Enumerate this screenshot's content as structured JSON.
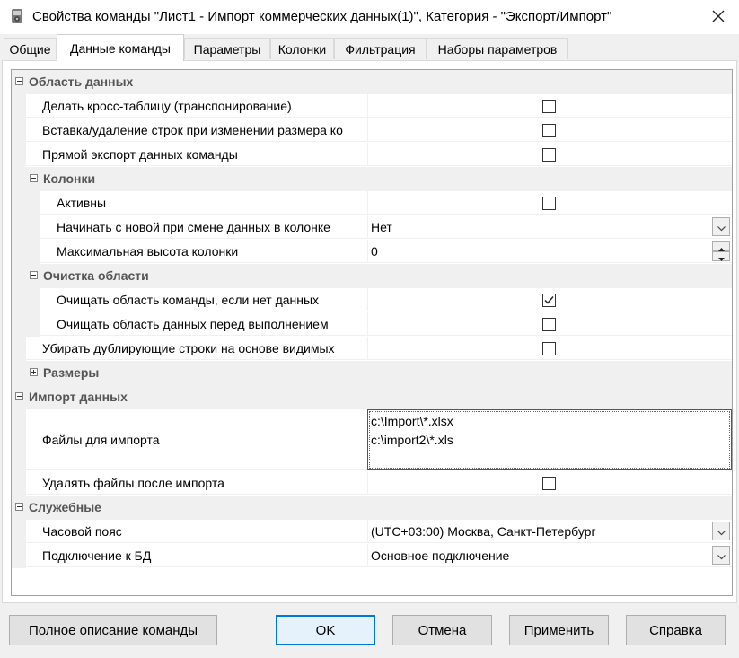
{
  "window": {
    "title": "Свойства команды \"Лист1 - Импорт коммерческих данных(1)\", Категория - \"Экспорт/Импорт\"",
    "icon": "gear-icon",
    "close_glyph": "✕"
  },
  "tabs": [
    {
      "label": "Общие",
      "active": false
    },
    {
      "label": "Данные команды",
      "active": true
    },
    {
      "label": "Параметры",
      "active": false
    },
    {
      "label": "Колонки",
      "active": false
    },
    {
      "label": "Фильтрация",
      "active": false
    },
    {
      "label": "Наборы параметров",
      "active": false
    }
  ],
  "grid": {
    "cat_data_area": "Область данных",
    "cross_table": {
      "label": "Делать кросс-таблицу (транспонирование)",
      "checked": false
    },
    "insert_delete_rows": {
      "label": "Вставка/удаление строк при изменении размера ко",
      "checked": false
    },
    "direct_export": {
      "label": "Прямой экспорт данных команды",
      "checked": false
    },
    "cat_columns": "Колонки",
    "active": {
      "label": "Активны",
      "checked": false
    },
    "start_new": {
      "label": "Начинать с новой при смене данных в колонке",
      "value": "Нет"
    },
    "max_height": {
      "label": "Максимальная высота колонки",
      "value": "0"
    },
    "cat_clear": "Очистка области",
    "clear_if_no_data": {
      "label": "Очищать область команды, если нет данных",
      "checked": true
    },
    "clear_before_exec": {
      "label": "Очищать область данных перед выполнением",
      "checked": false
    },
    "remove_duplicates": {
      "label": "Убирать дублирующие строки на основе видимых",
      "checked": false
    },
    "cat_sizes": "Размеры",
    "cat_import": "Импорт данных",
    "import_files": {
      "label": "Файлы для импорта",
      "lines": [
        "c:\\Import\\*.xlsx",
        "c:\\import2\\*.xls"
      ]
    },
    "delete_after_import": {
      "label": "Удалять файлы после импорта",
      "checked": false
    },
    "cat_service": "Служебные",
    "timezone": {
      "label": "Часовой пояс",
      "value": "(UTC+03:00) Москва, Санкт-Петербург"
    },
    "db_connection": {
      "label": "Подключение к БД",
      "value": "Основное подключение"
    }
  },
  "buttons": {
    "full_description": "Полное описание команды",
    "ok": "OK",
    "cancel": "Отмена",
    "apply": "Применить",
    "help": "Справка"
  },
  "colors": {
    "default_button_border": "#0078d7",
    "category_text": "#555555",
    "window_background": "#f0f0f0"
  }
}
